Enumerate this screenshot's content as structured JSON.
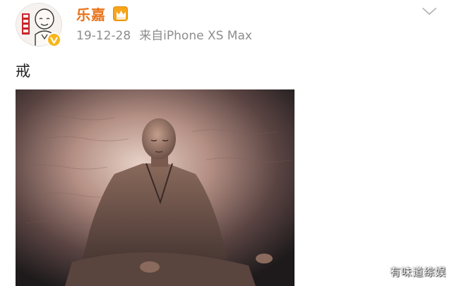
{
  "post": {
    "author": "乐嘉",
    "date": "19-12-28",
    "source": "来自iPhone XS Max",
    "text": "戒"
  },
  "watermark": "有味道综娱",
  "colors": {
    "username": "#e8731a",
    "meta": "#8d8d8d",
    "verified_badge": "#f8b51a"
  },
  "icons": {
    "avatar": "cartoon-bald-man-avatar",
    "verified": "verified-v-badge",
    "vip": "crown-icon",
    "menu": "chevron-down-icon"
  },
  "image": {
    "description_label": "post-photo"
  }
}
